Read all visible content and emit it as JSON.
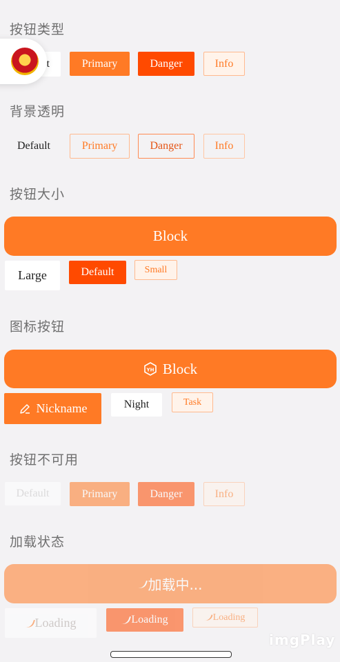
{
  "sections": {
    "types": "按钮类型",
    "plain": "背景透明",
    "sizes": "按钮大小",
    "icons": "图标按钮",
    "disabled": "按钮不可用",
    "loading": "加载状态"
  },
  "types": {
    "default": "t",
    "primary": "Primary",
    "danger": "Danger",
    "info": "Info"
  },
  "plain": {
    "default": "Default",
    "primary": "Primary",
    "danger": "Danger",
    "info": "Info"
  },
  "sizes": {
    "block": "Block",
    "large": "Large",
    "default": "Default",
    "small": "Small"
  },
  "icon_buttons": {
    "block": "Block",
    "nickname": "Nickname",
    "night": "Night",
    "task": "Task"
  },
  "disabled": {
    "default": "Default",
    "primary": "Primary",
    "danger": "Danger",
    "info": "Info"
  },
  "loading": {
    "block": "加载中...",
    "large": "Loading",
    "default": "Loading",
    "small": "Loading"
  },
  "watermark": "imgPlay",
  "icons": {
    "badge": "police-emblem-icon",
    "block": "yh-logo-icon",
    "nickname": "pencil-icon",
    "spinner": "spinner-icon"
  },
  "colors": {
    "primary": "#ff7a25",
    "danger": "#ff4a00",
    "info_bg": "#fff3ea",
    "background": "#f3f2f4"
  }
}
